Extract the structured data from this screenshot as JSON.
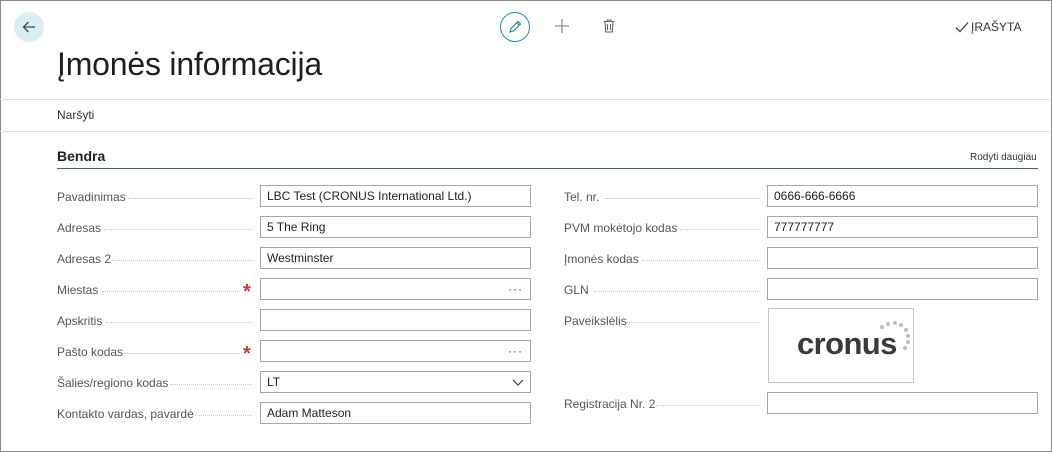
{
  "header": {
    "title": "Įmonės informacija",
    "saved_label": "ĮRAŠYTA"
  },
  "nav": {
    "item": "Naršyti"
  },
  "section": {
    "title": "Bendra",
    "show_more": "Rodyti daugiau"
  },
  "left_fields": [
    {
      "label": "Pavadinimas",
      "value": "LBC Test (CRONUS International Ltd.)"
    },
    {
      "label": "Adresas",
      "value": "5 The Ring"
    },
    {
      "label": "Adresas 2",
      "value": "Westminster"
    },
    {
      "label": "Miestas",
      "value": ""
    },
    {
      "label": "Apskritis",
      "value": ""
    },
    {
      "label": "Pašto kodas",
      "value": ""
    },
    {
      "label": "Šalies/regiono kodas",
      "value": "LT"
    },
    {
      "label": "Kontakto vardas, pavardė",
      "value": "Adam Matteson"
    }
  ],
  "right_fields": [
    {
      "label": "Tel. nr.",
      "value": "0666-666-6666"
    },
    {
      "label": "PVM mokėtojo kodas",
      "value": "777777777"
    },
    {
      "label": "Įmonės kodas",
      "value": ""
    },
    {
      "label": "GLN",
      "value": ""
    },
    {
      "label": "Paveikslėlis",
      "logo": "cronus"
    },
    {
      "label": "Registracija Nr. 2",
      "value": ""
    }
  ],
  "colors": {
    "accent": "#2a8b9a",
    "required": "#d13438",
    "back_bg": "#d9eef1"
  }
}
